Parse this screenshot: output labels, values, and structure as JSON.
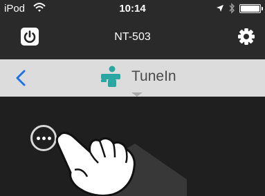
{
  "status_bar": {
    "carrier": "iPod",
    "time": "10:14",
    "battery_level": 1.0,
    "icons": [
      "wifi-icon",
      "location-arrow-icon",
      "bluetooth-icon",
      "battery-icon"
    ]
  },
  "header": {
    "device_name": "NT-503",
    "left_icon": "power-icon",
    "right_icon": "gear-icon"
  },
  "source_bar": {
    "back_icon": "chevron-left-icon",
    "source_icon": "tunein-logo-icon",
    "source_name": "TuneIn",
    "accent": "#2aa7a0",
    "back_color": "#1a73e8"
  },
  "content": {
    "more_icon": "ellipsis-circle-icon",
    "gesture_icon": "pointing-hand-icon"
  }
}
